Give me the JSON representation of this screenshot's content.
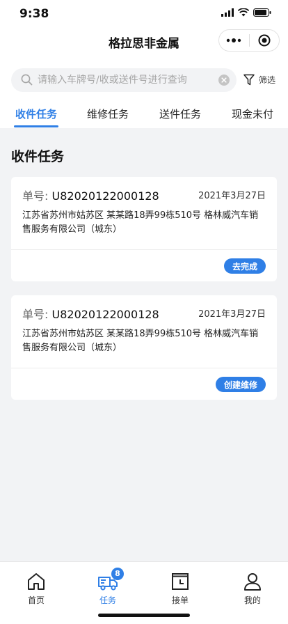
{
  "status_bar": {
    "time": "9:38"
  },
  "nav": {
    "title": "格拉思非金属"
  },
  "search": {
    "placeholder": "请输入车牌号/收或送件号进行查询",
    "value": "",
    "filter_label": "筛选"
  },
  "tabs": [
    {
      "label": "收件任务",
      "active": true
    },
    {
      "label": "维修任务",
      "active": false
    },
    {
      "label": "送件任务",
      "active": false
    },
    {
      "label": "现金未付",
      "active": false
    }
  ],
  "section_title": "收件任务",
  "cards": [
    {
      "order_label": "单号:",
      "order_no": "U82020122000128",
      "date": "2021年3月27日",
      "address": "江苏省苏州市姑苏区 某某路18弄99栋510号 格林威汽车销售服务有限公司（城东）",
      "action": "去完成"
    },
    {
      "order_label": "单号:",
      "order_no": "U82020122000128",
      "date": "2021年3月27日",
      "address": "江苏省苏州市姑苏区 某某路18弄99栋510号 格林威汽车销售服务有限公司（城东）",
      "action": "创建维修"
    }
  ],
  "tabbar": {
    "items": [
      {
        "label": "首页",
        "icon": "home-icon",
        "active": false
      },
      {
        "label": "任务",
        "icon": "truck-icon",
        "active": true,
        "badge": "8"
      },
      {
        "label": "接单",
        "icon": "clock-icon",
        "active": false
      },
      {
        "label": "我的",
        "icon": "user-icon",
        "active": false
      }
    ]
  },
  "colors": {
    "accent": "#2f7fe6",
    "background": "#f2f3f5"
  }
}
